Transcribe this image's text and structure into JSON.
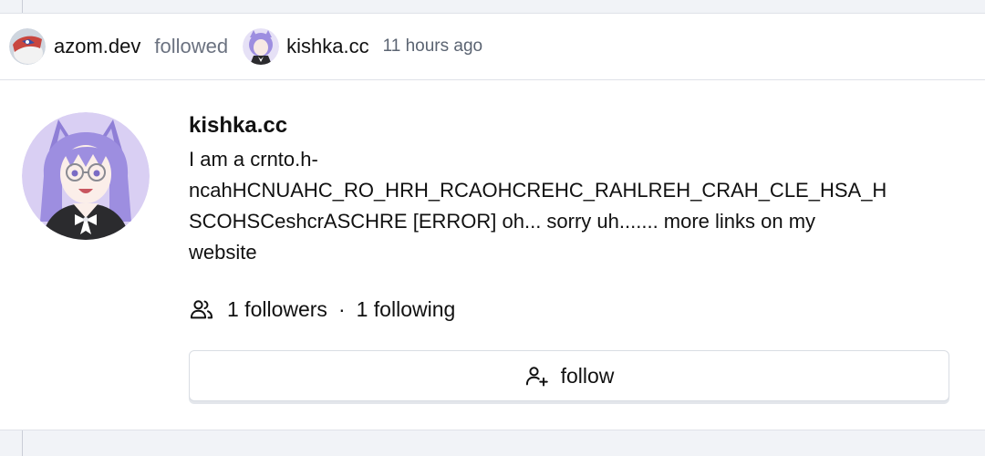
{
  "notification": {
    "actor_handle": "azom.dev",
    "verb": "followed",
    "target_handle": "kishka.cc",
    "time": "11 hours ago"
  },
  "profile": {
    "name": "kishka.cc",
    "bio_lines": [
      "I am a crnto.h-",
      "ncahHCNUAHC_RO_HRH_RCAOHCREHC_RAHLREH_CRAH_CLE_HSA_H",
      "SCOHSCeshcrASCHRE [ERROR] oh... sorry uh....... more links on my",
      "website"
    ],
    "followers": "1 followers",
    "separator": "·",
    "following": "1 following"
  },
  "actions": {
    "follow_label": "follow"
  },
  "icons": {
    "stats": "users-icon",
    "follow": "user-plus-icon"
  },
  "colors": {
    "avatar_purple": "#9d8ee0",
    "avatar_bg": "#d9cff3",
    "muted_text": "#6b7280"
  }
}
